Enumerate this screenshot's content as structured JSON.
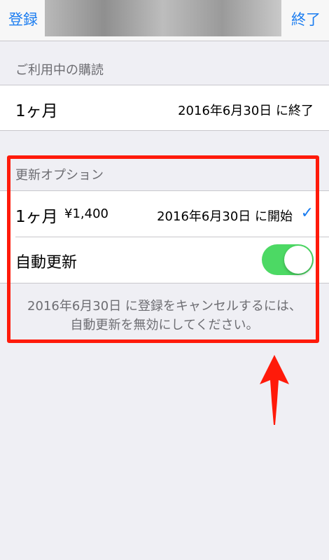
{
  "navbar": {
    "left_label": "登録",
    "right_label": "終了"
  },
  "current_subscription": {
    "header": "ご利用中の購読",
    "plan": "1ヶ月",
    "status": "2016年6月30日 に終了"
  },
  "renewal_options": {
    "header": "更新オプション",
    "plan": "1ヶ月",
    "price": "¥1,400",
    "start": "2016年6月30日 に開始",
    "auto_renew_label": "自動更新",
    "auto_renew_on": true,
    "footer_line1": "2016年6月30日 に登録をキャンセルするには、",
    "footer_line2": "自動更新を無効にしてください。"
  },
  "colors": {
    "accent": "#1a7cf0",
    "toggle_on": "#4cd964",
    "annotation": "#ff1a0a"
  },
  "icons": {
    "selected": "checkmark-icon",
    "annotation": "arrow-up-icon"
  }
}
